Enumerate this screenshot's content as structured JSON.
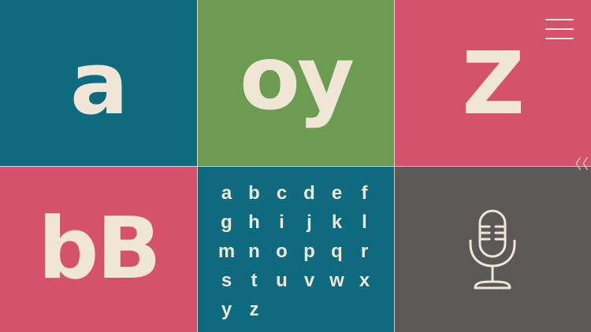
{
  "tiles": {
    "a": "a",
    "oy": "oy",
    "z": "Z",
    "bb": "bB"
  },
  "alphabet": [
    "a",
    "b",
    "c",
    "d",
    "e",
    "f",
    "g",
    "h",
    "i",
    "j",
    "k",
    "l",
    "m",
    "n",
    "o",
    "p",
    "q",
    "r",
    "s",
    "t",
    "u",
    "v",
    "w",
    "x",
    "y",
    "z"
  ],
  "icons": {
    "menu": "hamburger-menu-icon",
    "collapse": "double-chevron-left-icon",
    "microphone": "microphone-icon"
  },
  "controls": {
    "collapse_glyph": "〈〈"
  },
  "colors": {
    "teal": "#0d6a7f",
    "green": "#6c9b52",
    "pink": "#d4526c",
    "gray": "#5b5858",
    "cream": "#efe6d6"
  }
}
